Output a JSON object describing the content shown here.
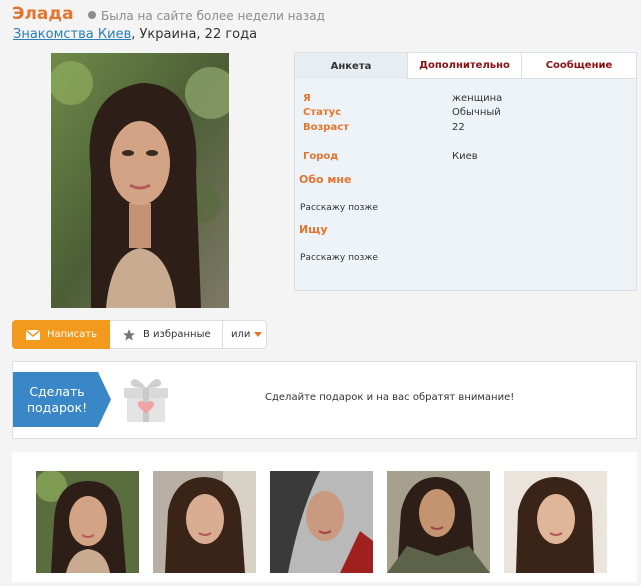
{
  "profile": {
    "name": "Элада",
    "status": "Была на сайте более недели назад",
    "location_link": "Знакомства Киев",
    "location_rest": ", Украина, 22 года"
  },
  "tabs": [
    "Анкета",
    "Дополнительно",
    "Сообщение"
  ],
  "info": {
    "rows": [
      {
        "label": "Я",
        "value": "женщина"
      },
      {
        "label": "Статус",
        "value": "Обычный"
      },
      {
        "label": "Возраст",
        "value": "22"
      },
      {
        "label": "Город",
        "value": "Киев"
      }
    ],
    "about_title": "Обо мне",
    "about_text": "Расскажу позже",
    "seek_title": "Ищу",
    "seek_text": "Расскажу позже"
  },
  "actions": {
    "write": "Написать",
    "favorites": "В избранные",
    "or": "или"
  },
  "gift": {
    "button_line1": "Сделать",
    "button_line2": "подарок!",
    "message": "Сделайте подарок и на вас обратят внимание!"
  },
  "colors": {
    "accent": "#e5742e",
    "link": "#2a7fb8",
    "tab_text": "#8b1010",
    "write_button": "#f39a1e",
    "gift_button": "#3a87c8"
  },
  "icons": {
    "status": "status-dot-icon",
    "write": "envelope-icon",
    "favorites": "star-icon",
    "more": "caret-down-icon",
    "gift": "gift-box-icon"
  }
}
